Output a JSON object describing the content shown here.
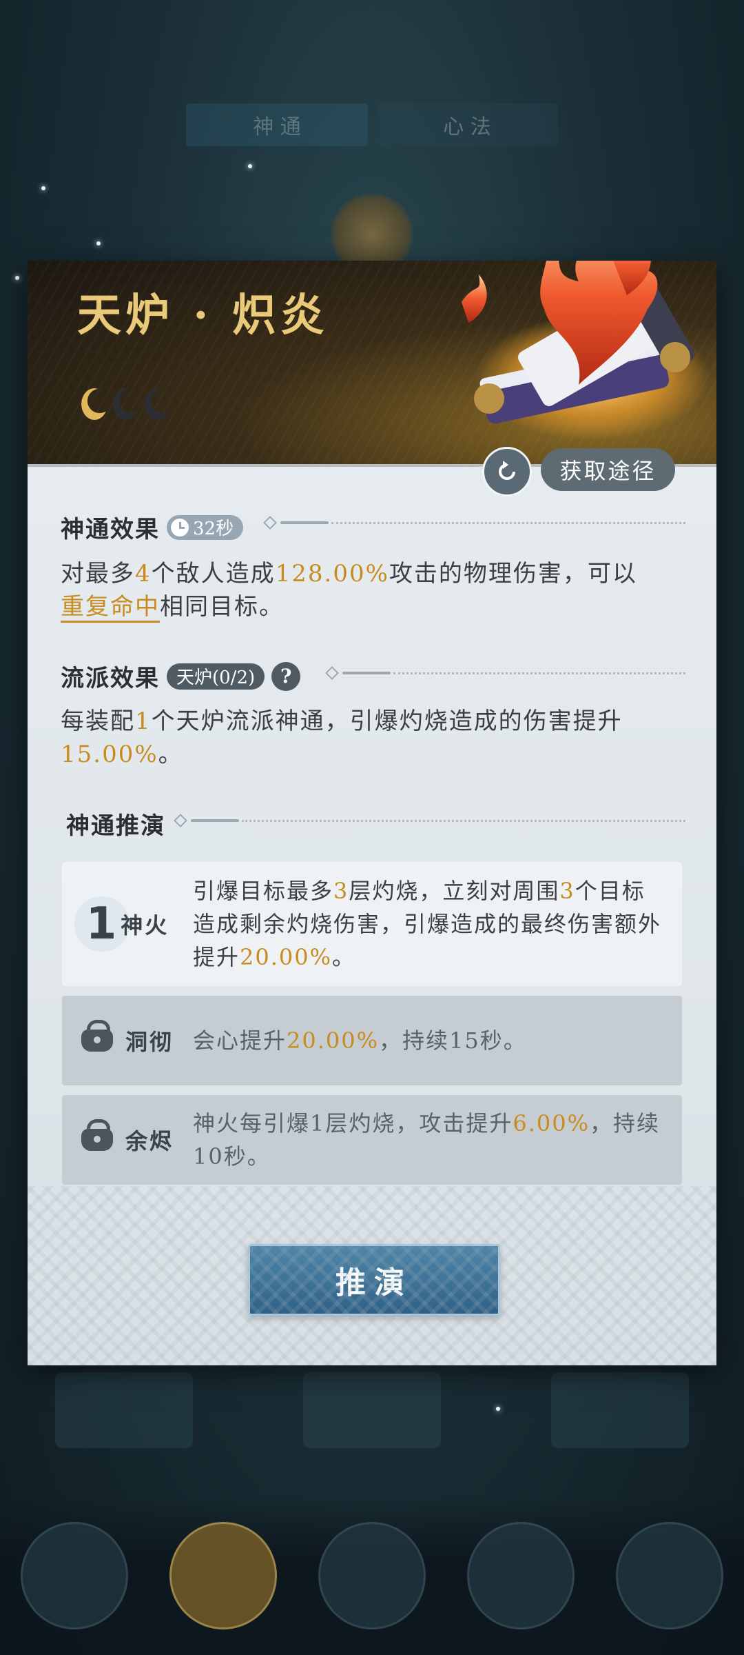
{
  "background": {
    "tab_left": "神 通",
    "tab_right": "心 法"
  },
  "skill": {
    "title": "天炉 · 炽炎",
    "rank_on": 1,
    "rank_total": 3,
    "refresh_icon": "refresh-icon",
    "source_label": "获取途径"
  },
  "effect": {
    "title": "神通效果",
    "cooldown": "32秒",
    "desc_1": "对最多",
    "desc_num1": "4",
    "desc_2": "个敌人造成",
    "desc_pct": "128.00%",
    "desc_3": "攻击的物理伤害，可以",
    "desc_link": "重复命中",
    "desc_4": "相同目标。"
  },
  "school": {
    "title": "流派效果",
    "badge": "天炉(0/2)",
    "help": "?",
    "desc_1": "每装配",
    "desc_num": "1",
    "desc_2": "个天炉流派神通，引爆灼烧造成的伤害提升",
    "desc_pct": "15.00%",
    "desc_3": "。"
  },
  "deduce": {
    "title": "神通推演",
    "tiers": [
      {
        "num": "1",
        "name": "神火",
        "state": "active",
        "d1": "引爆目标最多",
        "n1": "3",
        "d2": "层灼烧，立刻对周围",
        "n2": "3",
        "d3": "个目标造成剩余灼烧伤害，引爆造成的最终伤害额外提升",
        "pct": "20.00%",
        "d4": "。"
      },
      {
        "name": "洞彻",
        "state": "locked",
        "d1": "会心提升",
        "pct": "20.00%",
        "d2": "，持续15秒。"
      },
      {
        "name": "余烬",
        "state": "locked",
        "d1": "神火每引爆1层灼烧，攻击提升",
        "pct": "6.00%",
        "d2": "，持续10秒。"
      }
    ],
    "button_label": "推演"
  },
  "colors": {
    "highlight": "#c98b1e",
    "title_gold": "#e9c97a",
    "button_blue": "#2f6188"
  }
}
